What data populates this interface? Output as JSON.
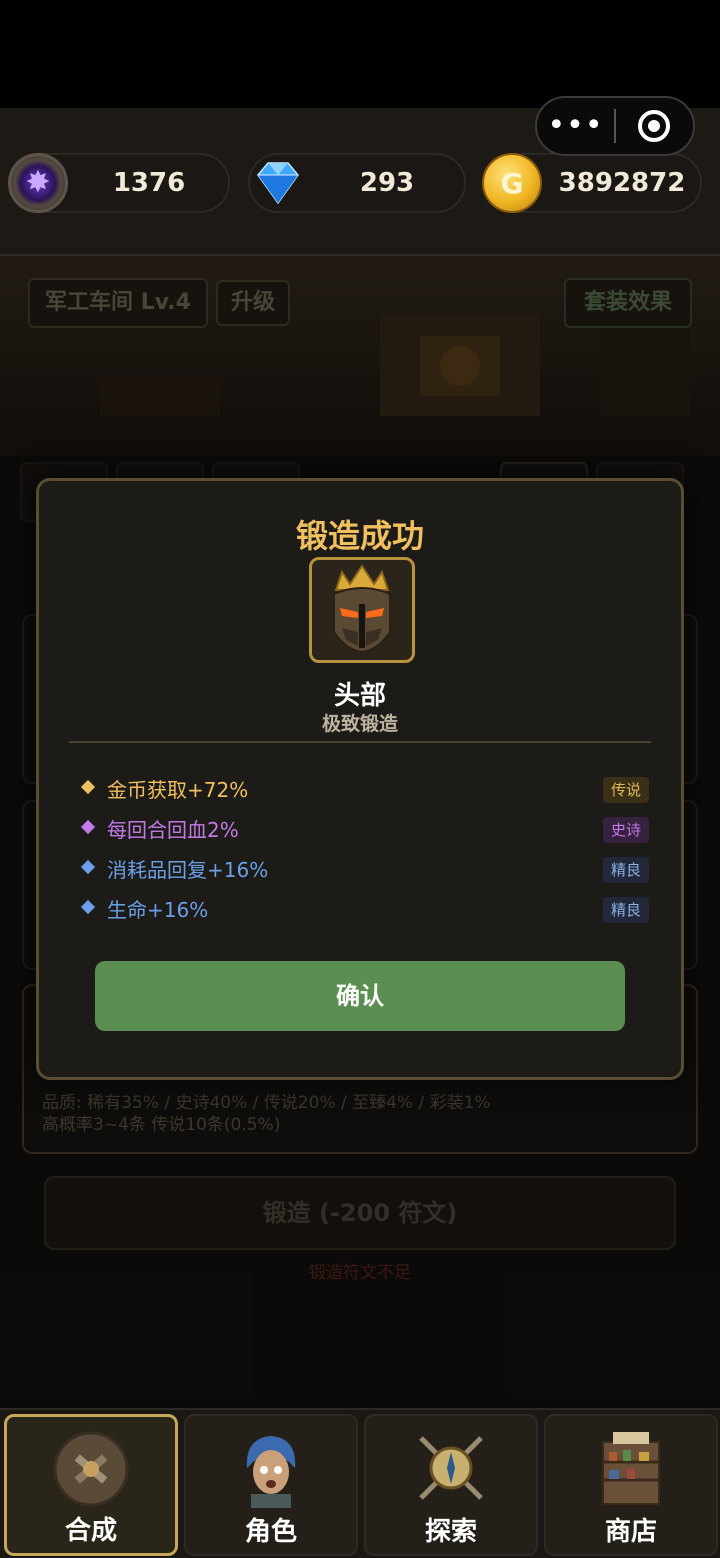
{
  "colors": {
    "legend": "#f0c060",
    "epic": "#c27ae8",
    "fine": "#6aa0e8",
    "confirm_bg": "#5b8f52",
    "gold_title": "#f0c060"
  },
  "capsule": {
    "more_icon": "more-dots-icon",
    "close_icon": "target-icon"
  },
  "currency": {
    "runes": {
      "icon": "rune-icon",
      "value": "1376"
    },
    "diamonds": {
      "icon": "diamond-icon",
      "value": "293"
    },
    "gold": {
      "icon": "gold-coin-icon",
      "value": "3892872"
    }
  },
  "workshop": {
    "title": "军工车间 Lv.4",
    "upgrade": "升级",
    "set_effect": "套装效果",
    "quality_line": "品质: 稀有35% / 史诗40% / 传说20% / 至臻4% / 彩装1%",
    "probability_line": "高概率3~4条  传说10条(0.5%)",
    "forge_button": "锻造 (-200 符文)",
    "forge_warning": "锻造符文不足"
  },
  "modal": {
    "title": "锻造成功",
    "item_icon": "helmet-icon",
    "item_name": "头部",
    "item_subtitle": "极致锻造",
    "affixes": [
      {
        "text": "金币获取+72%",
        "tag": "传说",
        "rarity": "legend"
      },
      {
        "text": "每回合回血2%",
        "tag": "史诗",
        "rarity": "epic"
      },
      {
        "text": "消耗品回复+16%",
        "tag": "精良",
        "rarity": "fine"
      },
      {
        "text": "生命+16%",
        "tag": "精良",
        "rarity": "fine"
      }
    ],
    "confirm": "确认"
  },
  "nav": [
    {
      "label": "合成",
      "icon": "craft-icon",
      "active": true
    },
    {
      "label": "角色",
      "icon": "character-icon",
      "active": false
    },
    {
      "label": "探索",
      "icon": "explore-compass-icon",
      "active": false
    },
    {
      "label": "商店",
      "icon": "shop-icon",
      "active": false
    }
  ]
}
